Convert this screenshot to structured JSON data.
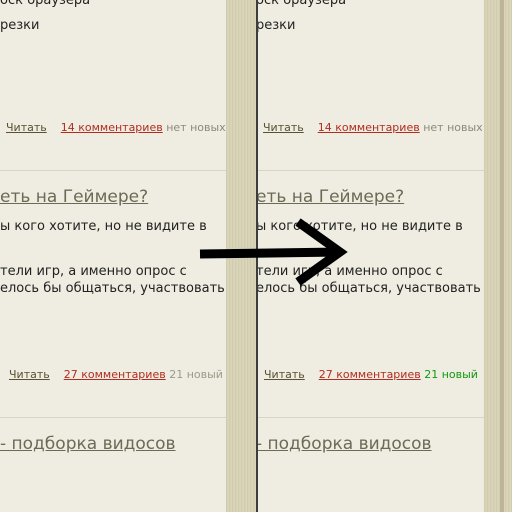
{
  "posts": [
    {
      "line1": "оск браузера",
      "line2": "резки",
      "read": "Читать",
      "comments": "14 комментариев",
      "new_left": "нет новых",
      "new_right": "нет новых"
    },
    {
      "title": "еть на Геймере?",
      "line1": "ы кого хотите, но не видите в",
      "line2": "тели игр, а именно опрос с",
      "line3": "елось бы общаться, участвовать",
      "read": "Читать",
      "comments": "27 комментариев",
      "new_left": "21 новый",
      "new_right": "21 новый"
    },
    {
      "title": "- подборка видосов"
    }
  ],
  "colors": {
    "background": "#efede1",
    "link_red": "#b22c20",
    "new_green": "#119911",
    "arrow": "#000000"
  }
}
